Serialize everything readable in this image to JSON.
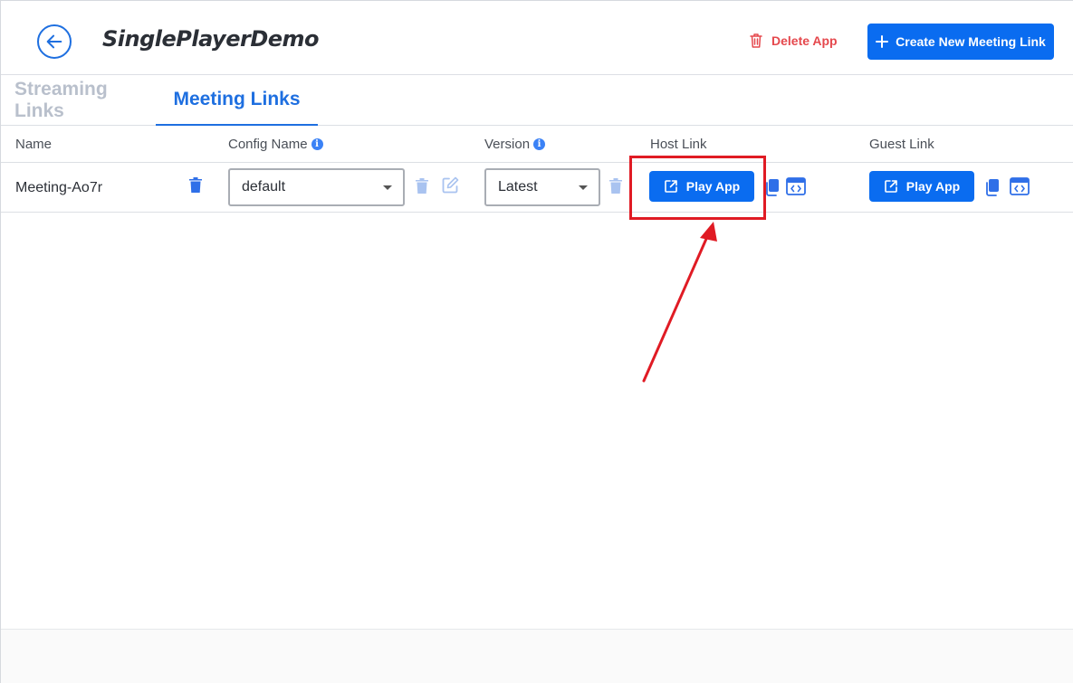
{
  "header": {
    "title": "SinglePlayerDemo",
    "back_icon": "arrow-left-icon",
    "delete_label": "Delete App",
    "create_label": "Create New Meeting Link"
  },
  "tabs": [
    {
      "label": "Streaming Links",
      "active": false
    },
    {
      "label": "Meeting Links",
      "active": true
    }
  ],
  "table": {
    "columns": {
      "name": "Name",
      "config": "Config Name",
      "version": "Version",
      "host": "Host Link",
      "guest": "Guest Link"
    },
    "rows": [
      {
        "name": "Meeting-Ao7r",
        "config": "default",
        "version": "Latest",
        "host_button": "Play App",
        "guest_button": "Play App"
      }
    ]
  },
  "colors": {
    "accent": "#0a6cf0",
    "danger": "#e5484d",
    "annotation": "#e01b24"
  }
}
